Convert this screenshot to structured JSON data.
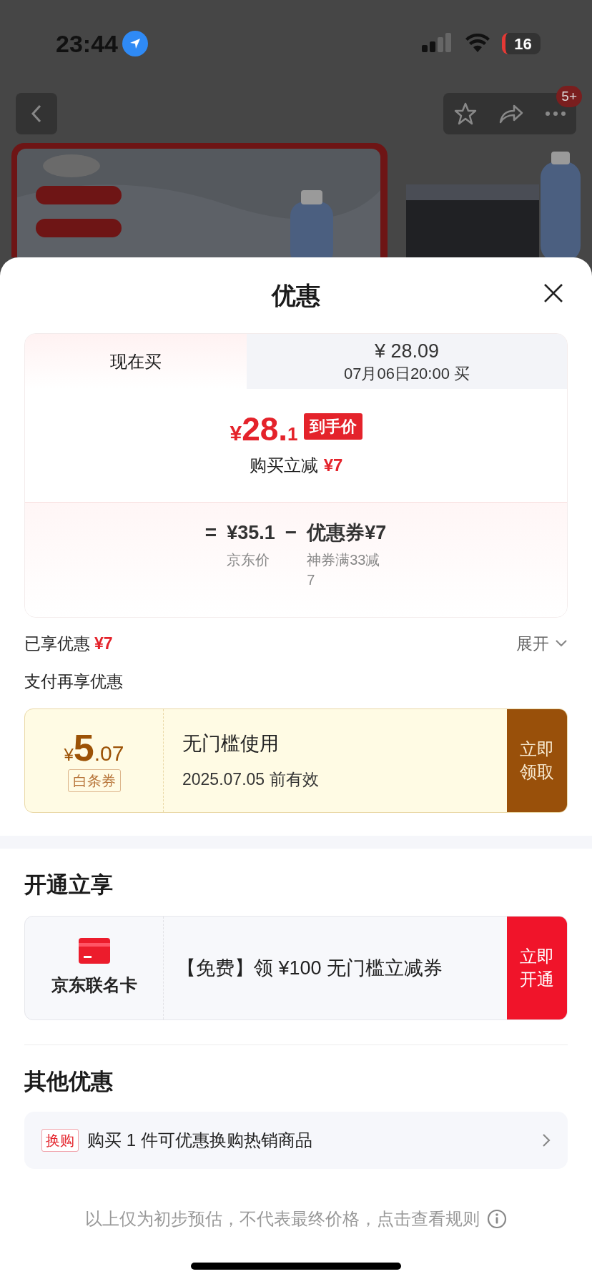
{
  "status_bar": {
    "time": "23:44",
    "battery": "16"
  },
  "nav": {
    "badge": "5+"
  },
  "sheet": {
    "title": "优惠",
    "tabs": [
      {
        "lines": [
          "现在买"
        ],
        "selected": true
      },
      {
        "lines": [
          "¥ 28.09",
          "07月06日20:00 买"
        ],
        "selected": false
      }
    ],
    "price": {
      "currency": "¥",
      "main": "28.",
      "decimal": "1",
      "tag": "到手价"
    },
    "instant_discount": {
      "label": "购买立减",
      "amount": "¥7"
    },
    "breakdown": [
      {
        "kind": "operator",
        "text": "="
      },
      {
        "kind": "amount",
        "value": "¥35.1",
        "note": "京东价"
      },
      {
        "kind": "operator",
        "text": "−"
      },
      {
        "kind": "amount",
        "value": "优惠券¥7",
        "note": "神券满33减7"
      }
    ],
    "enjoyed": {
      "label": "已享优惠",
      "amount": "¥7",
      "toggle": "展开"
    },
    "pay_title": "支付再享优惠",
    "pay_coupon": {
      "currency": "¥",
      "main": "5",
      "decimal": ".07",
      "tag": "白条券",
      "title": "无门槛使用",
      "validity": "2025.07.05 前有效",
      "button": "立即领取"
    },
    "open_section": {
      "title": "开通立享",
      "card_name": "京东联名卡",
      "offer": "【免费】领 ¥100 无门槛立减券",
      "button": "立即开通"
    },
    "other": {
      "title": "其他优惠",
      "items": [
        {
          "tag": "换购",
          "text": "购买 1 件可优惠换购热销商品"
        }
      ]
    },
    "footer": "以上仅为初步预估，不代表最终价格，点击查看规则"
  }
}
